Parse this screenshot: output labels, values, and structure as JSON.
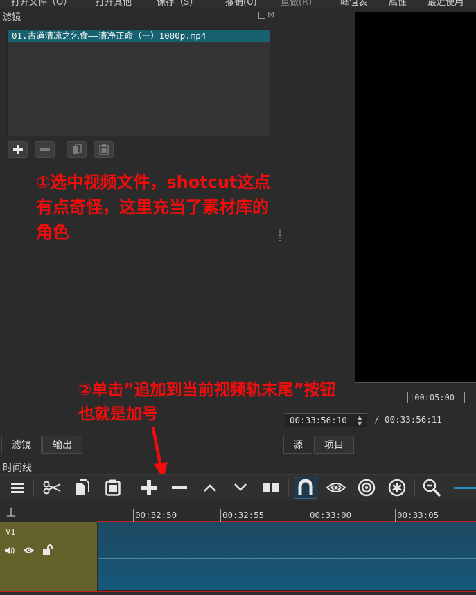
{
  "menubar": {
    "items": [
      {
        "label": "打开文件（O）",
        "enabled": true
      },
      {
        "label": "打开其他",
        "enabled": true
      },
      {
        "label": "保存（S）",
        "enabled": true
      },
      {
        "label": "撤销(U)",
        "enabled": true
      },
      {
        "label": "重做(R)",
        "enabled": false
      },
      {
        "label": "峰值表",
        "enabled": true
      },
      {
        "label": "属性",
        "enabled": true
      },
      {
        "label": "最近使用",
        "enabled": true
      }
    ]
  },
  "filters_panel": {
    "title": "滤镜",
    "file_item": "01.古道清凉之乞食——清净正命（一）1080p.mp4"
  },
  "annotations": {
    "step1": [
      "①选中视频文件，shotcut这点",
      "有点奇怪，这里充当了素材库的",
      "角色"
    ],
    "step2": [
      "②单击”追加到当前视频轨末尾”按钮",
      "也就是加号"
    ]
  },
  "player": {
    "ruler_label": "|00:05:00",
    "current_time": "00:33:56:10",
    "duration": "/ 00:33:56:11"
  },
  "tabs": {
    "filters": "滤镜",
    "output": "输出",
    "source": "源",
    "project": "项目"
  },
  "timeline": {
    "title": "时间线",
    "master_label": "主",
    "ruler_labels": [
      "00:32:50",
      "00:32:55",
      "00:33:00",
      "00:33:05"
    ],
    "track_name": "V1",
    "accent": "#2a8ec0",
    "track_head_color": "#64622a",
    "playhead_color": "#c02020"
  },
  "colors": {
    "selection": "#186171",
    "annotation": "#f20d0d",
    "background": "#2b2b2b"
  }
}
